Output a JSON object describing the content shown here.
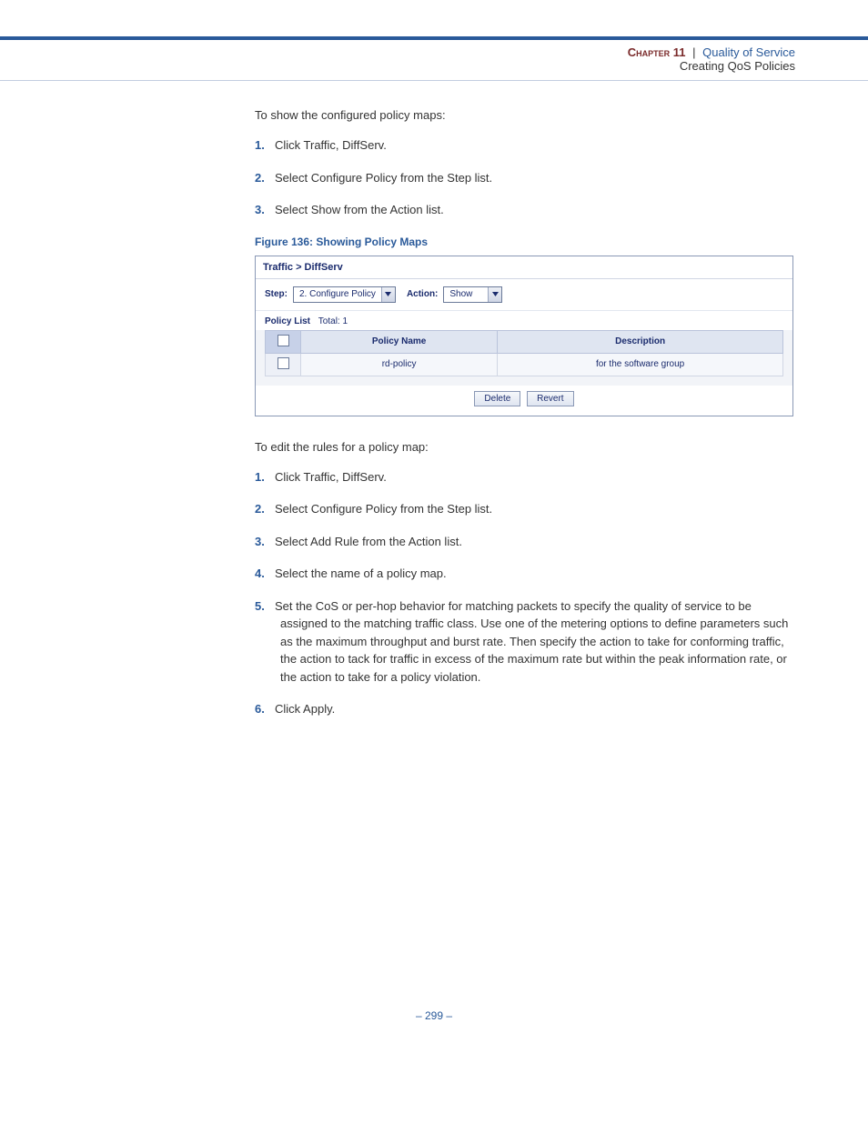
{
  "header": {
    "chapter": "Chapter 11",
    "pipe": "|",
    "title": "Quality of Service",
    "subtitle": "Creating QoS Policies"
  },
  "body": {
    "intro1": "To show the configured policy maps:",
    "list1": [
      "Click Traffic, DiffServ.",
      "Select Configure Policy from the Step list.",
      "Select Show from the Action list."
    ],
    "figcap": "Figure 136:  Showing Policy Maps",
    "intro2": "To edit the rules for a policy map:",
    "list2": [
      "Click Traffic, DiffServ.",
      "Select Configure Policy from the Step list.",
      "Select Add Rule from the Action list.",
      "Select the name of a policy map.",
      "Set the CoS or per-hop behavior for matching packets to specify the quality of service to be assigned to the matching traffic class. Use one of the metering options to define parameters such as the maximum throughput and burst rate. Then specify the action to take for conforming traffic, the action to tack for traffic in excess of the maximum rate but within the peak information rate, or the action to take for a policy violation.",
      "Click Apply."
    ]
  },
  "screenshot": {
    "breadcrumb": "Traffic > DiffServ",
    "step_label": "Step:",
    "step_value": "2. Configure Policy",
    "action_label": "Action:",
    "action_value": "Show",
    "list_title": "Policy List",
    "list_total": "Total: 1",
    "col_policy": "Policy Name",
    "col_desc": "Description",
    "row_policy": "rd-policy",
    "row_desc": "for the software group",
    "btn_delete": "Delete",
    "btn_revert": "Revert"
  },
  "footer": {
    "page": "–  299  –"
  }
}
